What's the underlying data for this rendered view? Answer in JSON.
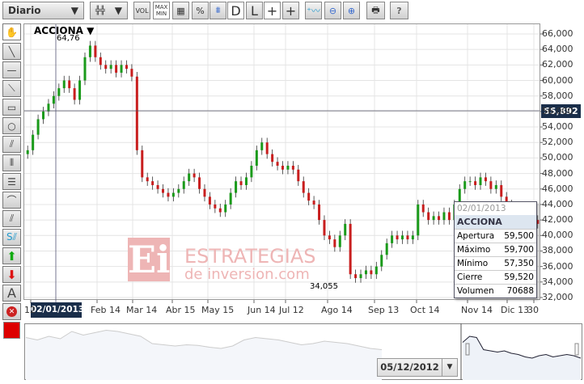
{
  "toolbar": {
    "period": "Diario",
    "chart_type_icon": "candlestick-icon",
    "vol": "VOL",
    "maxmin_top": "MAX",
    "maxmin_bottom": "MIN",
    "percent": "%",
    "d": "D",
    "l": "L",
    "help": "?"
  },
  "chart": {
    "symbol": "ACCIONA",
    "max_label": "64,76",
    "min_label": "34,055",
    "current_price": "55,892",
    "crosshair_date": "02/01/2013",
    "watermark": {
      "logo": "Ei",
      "line1": "ESTRATEGIAS",
      "line2": "de inversion.com"
    }
  },
  "tooltip": {
    "date": "02/01/2013",
    "name": "ACCIONA",
    "rows": [
      {
        "k": "Apertura",
        "v": "59,500"
      },
      {
        "k": "Máximo",
        "v": "59,700"
      },
      {
        "k": "Mínimo",
        "v": "57,350"
      },
      {
        "k": "Cierre",
        "v": "59,520"
      },
      {
        "k": "Volumen",
        "v": "70688"
      }
    ]
  },
  "navigator": {
    "date": "05/12/2012"
  },
  "chart_data": {
    "type": "candlestick",
    "ylim": [
      32,
      67
    ],
    "y_ticks": [
      "32,000",
      "34,000",
      "36,000",
      "38,000",
      "40,000",
      "42,000",
      "44,000",
      "46,000",
      "48,000",
      "50,000",
      "52,000",
      "54,000",
      "56,000",
      "58,000",
      "60,000",
      "62,000",
      "64,000",
      "66,000"
    ],
    "x_ticks": [
      "12",
      "Feb 14",
      "Mar 14",
      "Abr 15",
      "May 15",
      "Jun 14",
      "Jul 12",
      "Ago 14",
      "Sep 13",
      "Oct 14",
      "Nov 14",
      "Dic 13",
      "30"
    ],
    "closes": [
      51,
      53,
      55,
      56,
      57,
      58,
      59,
      60,
      59,
      57.5,
      60,
      63,
      64.5,
      63,
      62,
      61.5,
      62,
      61,
      62,
      61.5,
      60.5,
      51,
      47.5,
      47,
      46.5,
      46,
      45.5,
      45,
      45.5,
      46,
      47,
      48,
      47.5,
      46,
      45,
      44,
      43.5,
      43,
      44,
      45.5,
      47,
      46.5,
      47.5,
      49,
      51,
      52,
      50.5,
      49.5,
      49,
      48.5,
      49,
      48.5,
      47,
      45.5,
      44.5,
      44,
      42,
      40,
      39.5,
      38.5,
      40,
      41.5,
      35,
      34.5,
      35,
      35.5,
      35,
      36,
      37.5,
      39,
      40,
      39.5,
      40,
      39.5,
      40,
      44,
      43,
      42,
      42.5,
      42,
      43,
      42,
      44,
      46,
      47,
      47,
      46.5,
      47.5,
      47,
      46,
      46.5,
      45,
      44,
      42,
      41,
      41,
      40.5,
      42,
      41.5
    ],
    "navigator_history": [
      70,
      66,
      72,
      68,
      80,
      74,
      78,
      82,
      80,
      76,
      72,
      60,
      58,
      56,
      58,
      57,
      54,
      52,
      56,
      66,
      70,
      68,
      66,
      62,
      58,
      60,
      64,
      62,
      60,
      56,
      52,
      50
    ],
    "navigator_selected": [
      62,
      72,
      70,
      50,
      48,
      46,
      48,
      44,
      42,
      38,
      36,
      40,
      42,
      38,
      40,
      42,
      40,
      36
    ]
  }
}
